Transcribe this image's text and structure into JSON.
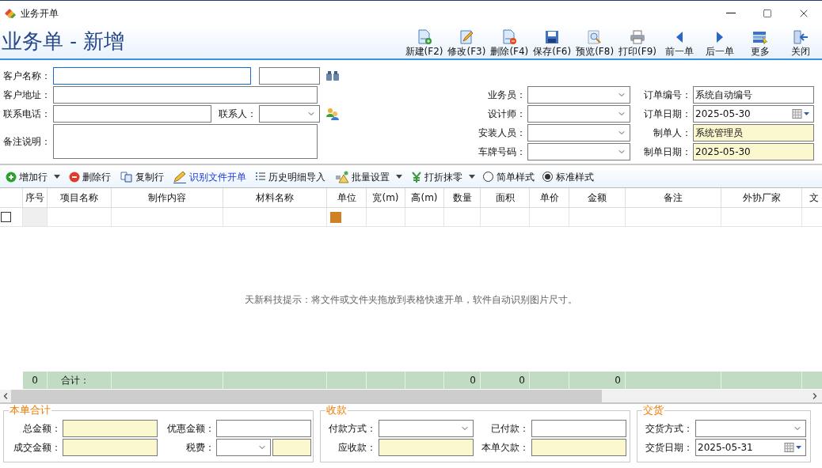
{
  "window": {
    "title": "业务开单"
  },
  "header": {
    "title": "业务单 - 新增"
  },
  "toolbar": [
    {
      "label": "新建(F2)"
    },
    {
      "label": "修改(F3)"
    },
    {
      "label": "删除(F4)"
    },
    {
      "label": "保存(F6)"
    },
    {
      "label": "预览(F8)"
    },
    {
      "label": "打印(F9)"
    },
    {
      "label": "前一单"
    },
    {
      "label": "后一单"
    },
    {
      "label": "更多"
    },
    {
      "label": "关闭"
    }
  ],
  "customer": {
    "name": {
      "label": "客户名称：",
      "kind": "text",
      "readonly": false,
      "focused": true
    },
    "code": {
      "kind": "text",
      "readonly": false,
      "focused": false
    },
    "address": {
      "label": "客户地址：",
      "kind": "text",
      "readonly": false,
      "focused": false
    },
    "phone": {
      "label": "联系电话：",
      "kind": "text",
      "readonly": false,
      "focused": false
    },
    "contact": {
      "label": "联系人：",
      "kind": "select",
      "readonly": false,
      "focused": false
    },
    "remark": {
      "label": "备注说明：",
      "kind": "memo",
      "readonly": false,
      "focused": false
    }
  },
  "staff": [
    {
      "label": "业务员：",
      "kind": "select",
      "readonly": false,
      "focused": false
    },
    {
      "label": "设计师：",
      "kind": "select",
      "readonly": false,
      "focused": false
    },
    {
      "label": "安装人员：",
      "kind": "select",
      "readonly": false,
      "focused": false
    },
    {
      "label": "车牌号码：",
      "kind": "select",
      "readonly": false,
      "focused": false
    }
  ],
  "order": [
    {
      "label": "订单编号：",
      "value": "系统自动编号",
      "kind": "text",
      "readonly": false,
      "focused": false
    },
    {
      "label": "订单日期：",
      "value": "2025-05-30",
      "kind": "date",
      "readonly": false,
      "focused": false
    },
    {
      "label": "制单人：",
      "value": "系统管理员",
      "kind": "text",
      "readonly": true,
      "focused": false
    },
    {
      "label": "制单日期：",
      "value": "2025-05-30",
      "kind": "text",
      "readonly": true,
      "focused": false
    }
  ],
  "row_tools": [
    {
      "label": "增加行",
      "kind": "button",
      "menu": true
    },
    {
      "label": "删除行",
      "kind": "button",
      "menu": false
    },
    {
      "label": "复制行",
      "kind": "button",
      "menu": false
    },
    {
      "label": "识别文件开单",
      "kind": "link"
    },
    {
      "label": "历史明细导入",
      "kind": "button",
      "menu": false
    },
    {
      "label": "批量设置",
      "kind": "button",
      "menu": true
    },
    {
      "label": "打折抹零",
      "kind": "button",
      "menu": true
    },
    {
      "label": "简单样式",
      "kind": "radio",
      "selected": false
    },
    {
      "label": "标准样式",
      "kind": "radio",
      "selected": true
    }
  ],
  "table": {
    "columns": [
      {
        "label": "序号",
        "total": "0"
      },
      {
        "label": "项目名称",
        "total": "合计："
      },
      {
        "label": "制作内容"
      },
      {
        "label": "材料名称"
      },
      {
        "label": "单位"
      },
      {
        "label": "宽(m)"
      },
      {
        "label": "高(m)"
      },
      {
        "label": "数量",
        "total": "0"
      },
      {
        "label": "面积",
        "total": "0"
      },
      {
        "label": "单价"
      },
      {
        "label": "金额",
        "total": "0"
      },
      {
        "label": "备注"
      },
      {
        "label": "外协厂家"
      },
      {
        "label": "文"
      }
    ],
    "rows": [
      {
        "checked": false
      }
    ],
    "hint": "天新科技提示：将文件或文件夹拖放到表格快速开单，软件自动识别图片尺寸。"
  },
  "summary": {
    "title": "本单合计",
    "fields": [
      {
        "label": "总金额：",
        "kind": "text",
        "readonly": true,
        "focused": false
      },
      {
        "label": "优惠金额：",
        "kind": "text",
        "readonly": false,
        "focused": false
      },
      {
        "label": "成交金额：",
        "kind": "text",
        "readonly": true,
        "focused": false
      },
      {
        "label": "税费：",
        "kind": "tax",
        "readonly": true,
        "focused": false
      }
    ]
  },
  "payment": {
    "title": "收款",
    "fields": [
      {
        "label": "付款方式：",
        "kind": "select",
        "readonly": false,
        "focused": false
      },
      {
        "label": "已付款：",
        "kind": "text",
        "readonly": false,
        "focused": false
      },
      {
        "label": "应收款：",
        "kind": "text",
        "readonly": true,
        "focused": false
      },
      {
        "label": "本单欠款：",
        "kind": "text",
        "readonly": true,
        "focused": false
      }
    ]
  },
  "delivery": {
    "title": "交货",
    "fields": [
      {
        "label": "交货方式：",
        "kind": "select",
        "readonly": false,
        "focused": false
      },
      {
        "label": "交货日期：",
        "value": "2025-05-31",
        "kind": "date",
        "readonly": false,
        "focused": false
      }
    ]
  }
}
